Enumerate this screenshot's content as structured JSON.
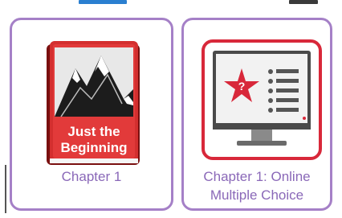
{
  "cards": [
    {
      "title": "Chapter 1",
      "cover": {
        "line1": "Just the",
        "line2": "Beginning"
      }
    },
    {
      "title_line1": "Chapter 1: Online",
      "title_line2": "Multiple Choice",
      "icon_glyph": "?"
    }
  ],
  "colors": {
    "card_border": "#a580c7",
    "label_text": "#8a68b8",
    "book_red": "#d32f2f",
    "monitor_red": "#d8283a"
  }
}
